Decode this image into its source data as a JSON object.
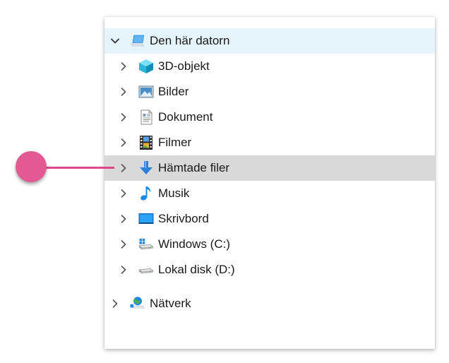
{
  "tree": {
    "root": {
      "label": "Den här datorn",
      "icon": "computer-icon"
    },
    "items": [
      {
        "label": "3D-objekt",
        "icon": "cube-icon"
      },
      {
        "label": "Bilder",
        "icon": "pictures-icon"
      },
      {
        "label": "Dokument",
        "icon": "document-icon"
      },
      {
        "label": "Filmer",
        "icon": "film-icon"
      },
      {
        "label": "Hämtade filer",
        "icon": "download-arrow-icon"
      },
      {
        "label": "Musik",
        "icon": "music-note-icon"
      },
      {
        "label": "Skrivbord",
        "icon": "desktop-icon"
      },
      {
        "label": "Windows (C:)",
        "icon": "windows-drive-icon"
      },
      {
        "label": "Lokal disk (D:)",
        "icon": "disk-drive-icon"
      }
    ],
    "network": {
      "label": "Nätverk",
      "icon": "network-icon"
    }
  },
  "colors": {
    "root_highlight": "#e5f3fb",
    "hover_highlight": "#d9d9d9",
    "callout": "#e35a93"
  }
}
